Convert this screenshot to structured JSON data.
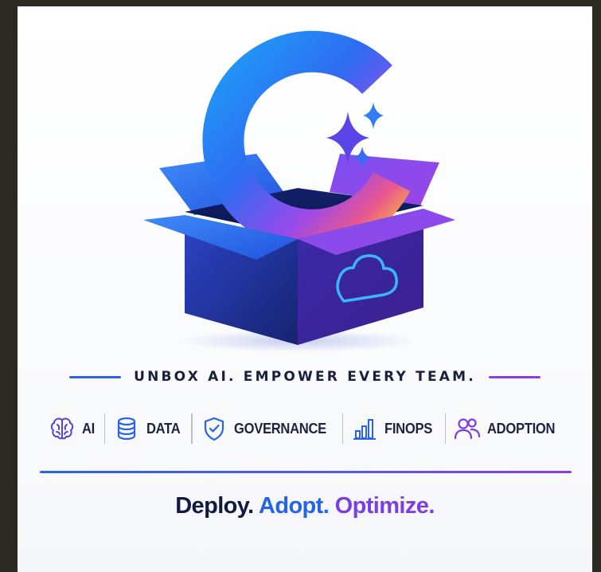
{
  "tagline": "UNBOX AI. EMPOWER EVERY TEAM.",
  "features": [
    {
      "label": "AI",
      "icon": "brain-icon"
    },
    {
      "label": "DATA",
      "icon": "database-icon"
    },
    {
      "label": "GOVERNANCE",
      "icon": "shield-check-icon"
    },
    {
      "label": "FINOPS",
      "icon": "bar-chart-icon"
    },
    {
      "label": "ADOPTION",
      "icon": "users-icon"
    }
  ],
  "slogan": {
    "part1": "Deploy.",
    "part2": "Adopt.",
    "part3": "Optimize."
  },
  "hero": {
    "logo_icon": "c-logo-icon",
    "sparkle_icon": "sparkle-icon",
    "box_icon": "open-box-icon",
    "cloud_icon": "cloud-icon"
  },
  "colors": {
    "blue": "#2563eb",
    "purple": "#7b3fe0",
    "navy": "#111a3d",
    "background": "#ffffff"
  }
}
